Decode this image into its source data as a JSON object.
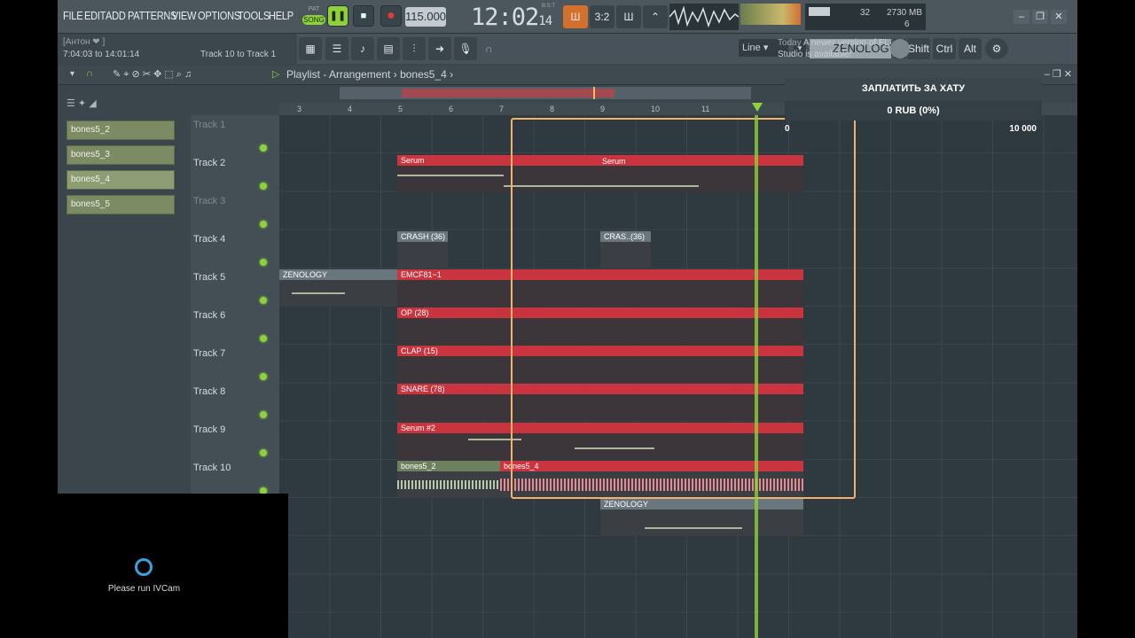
{
  "menu": [
    "FILE",
    "EDIT",
    "ADD",
    "PATTERNS",
    "VIEW",
    "OPTIONS",
    "TOOLS",
    "HELP"
  ],
  "transport": {
    "pat": "PAT",
    "song": "SONG",
    "tempo": "115.000",
    "time_main": "12:02",
    "time_sub": "14",
    "bst": "B:S:T"
  },
  "system": {
    "cpu": "32",
    "ram": "2730 MB",
    "poly": "6"
  },
  "hint": {
    "user": "[Антон ❤  ]",
    "range": "7:04:03 to 14:01:14",
    "track": "Track 10 to Track 1"
  },
  "toolbar": {
    "snap": "Line",
    "plugin": "ZENOLOGY",
    "shift": "Shift",
    "ctrl": "Ctrl",
    "alt": "Alt"
  },
  "news": {
    "when": "Today",
    "text": "A newer version of FL Studio is available!"
  },
  "playlist": {
    "title": "Playlist - Arrangement",
    "pattern": "bones5_4"
  },
  "browser": [
    "bones5_2",
    "bones5_3",
    "bones5_4",
    "bones5_5"
  ],
  "ruler": [
    "3",
    "4",
    "5",
    "6",
    "7",
    "8",
    "9",
    "10",
    "11"
  ],
  "tracks": [
    "Track 1",
    "Track 2",
    "Track 3",
    "Track 4",
    "Track 5",
    "Track 6",
    "Track 7",
    "Track 8",
    "Track 9",
    "Track 10"
  ],
  "clips": {
    "serum": "Serum",
    "crash": "CRASH (36)",
    "crash2": "CRAS..(36)",
    "emc": "EMCF81~1",
    "op": "OP (28)",
    "clap": "CLAP (15)",
    "snare": "SNARE (78)",
    "serum2": "Serum #2",
    "zen": "ZENOLOGY",
    "b2": "bones5_2",
    "b4": "bones5_4"
  },
  "overlay": {
    "title": "ЗАПЛАТИТЬ ЗА ХАТУ",
    "amount": "0 RUB (0%)",
    "min": "0",
    "max": "10 000"
  },
  "cam": {
    "text": "Please run IVCam"
  }
}
